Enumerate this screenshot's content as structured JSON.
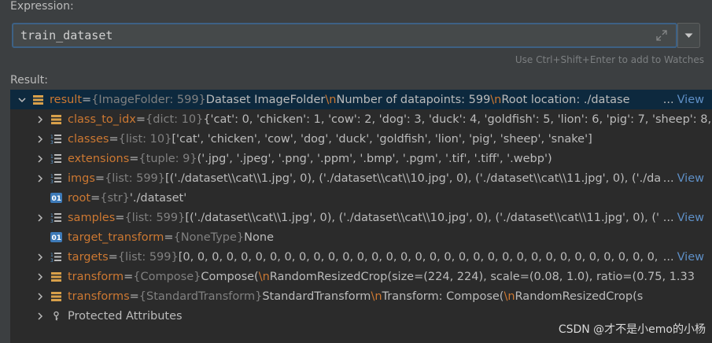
{
  "expression": {
    "label": "Expression:",
    "value": "train_dataset",
    "hint": "Use Ctrl+Shift+Enter to add to Watches"
  },
  "result": {
    "label": "Result:",
    "root": {
      "name": "result",
      "eq": " = ",
      "type": "{ImageFolder: 599}",
      "value_a": " Dataset ImageFolder",
      "esc1": "\\n",
      "value_b": "    Number of datapoints: 599",
      "esc2": "\\n",
      "value_c": "    Root location: ./datase",
      "view": "View"
    },
    "rows": [
      {
        "name": "class_to_idx",
        "type": "{dict: 10}",
        "value": " {'cat': 0, 'chicken': 1, 'cow': 2, 'dog': 3, 'duck': 4, 'goldfish': 5, 'lion': 6, 'pig': 7, 'sheep': 8,",
        "view": ""
      },
      {
        "name": "classes",
        "type": "{list: 10}",
        "value": " ['cat', 'chicken', 'cow', 'dog', 'duck', 'goldfish', 'lion', 'pig', 'sheep', 'snake']",
        "view": ""
      },
      {
        "name": "extensions",
        "type": "{tuple: 9}",
        "value": " ('.jpg', '.jpeg', '.png', '.ppm', '.bmp', '.pgm', '.tif', '.tiff', '.webp')",
        "view": ""
      },
      {
        "name": "imgs",
        "type": "{list: 599}",
        "value": " [('./dataset\\\\cat\\\\1.jpg', 0), ('./dataset\\\\cat\\\\10.jpg', 0), ('./dataset\\\\cat\\\\11.jpg', 0), ('./da",
        "view": "View"
      },
      {
        "name": "root",
        "type": "{str}",
        "value": " './dataset'",
        "view": ""
      },
      {
        "name": "samples",
        "type": "{list: 599}",
        "value": " [('./dataset\\\\cat\\\\1.jpg', 0), ('./dataset\\\\cat\\\\10.jpg', 0), ('./dataset\\\\cat\\\\11.jpg', 0), ('",
        "view": "View"
      },
      {
        "name": "target_transform",
        "type": "{NoneType}",
        "value": " None",
        "view": ""
      },
      {
        "name": "targets",
        "type": "{list: 599}",
        "value": " [0, 0, 0, 0, 0, 0, 0, 0, 0, 0, 0, 0, 0, 0, 0, 0, 0, 0, 0, 0, 0, 0, 0, 0, 0, 0, 0, 0, 0, 0, 0, 0, 0, 0, 0, 0",
        "view": "View"
      },
      {
        "name": "transform",
        "type": "{Compose}",
        "value": " Compose(",
        "esc": "\\n",
        "value2": "    RandomResizedCrop(size=(224, 224), scale=(0.08, 1.0), ratio=(0.75, 1.33",
        "view": ""
      },
      {
        "name": "transforms",
        "type": "{StandardTransform}",
        "value": " StandardTransform",
        "esc": "\\n",
        "value2": "Transform: Compose(",
        "esc2": "\\n",
        "value3": "           RandomResizedCrop(s",
        "view": ""
      }
    ],
    "protected": "Protected Attributes"
  },
  "watermark": "CSDN @才不是小emo的小杨",
  "colors": {
    "background": "#3c3f41",
    "tree_background": "#2b2b2b",
    "selected_row": "#0d293e",
    "attr_name": "#cc7832",
    "type_text": "#808080",
    "view_link": "#5e8fc6",
    "focus_border": "#3d6185"
  }
}
